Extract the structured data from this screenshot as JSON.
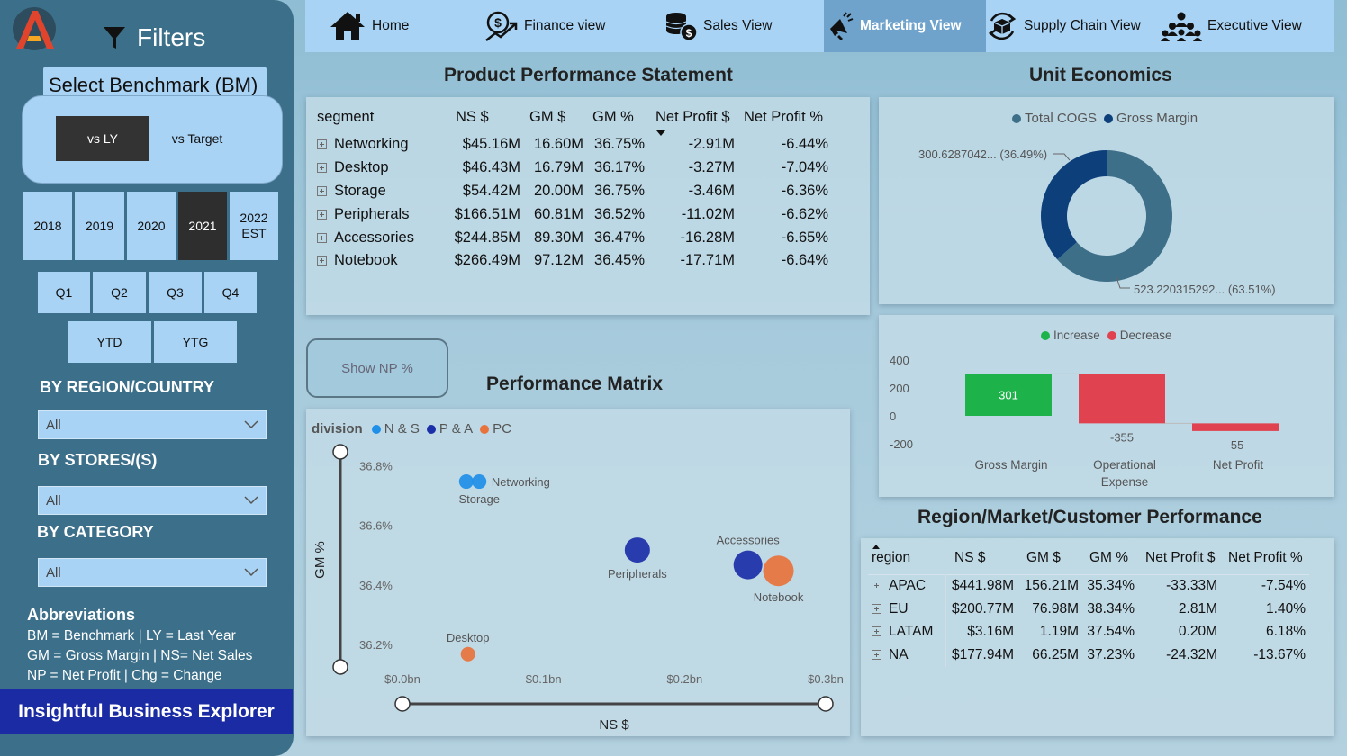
{
  "sidebar": {
    "filters_title": "Filters",
    "benchmark_label": "Select Benchmark (BM)",
    "benchmark_options": [
      "vs LY",
      "vs Target"
    ],
    "benchmark_selected": "vs LY",
    "years": [
      "2018",
      "2019",
      "2020",
      "2021",
      "2022 EST"
    ],
    "year_selected": "2021",
    "quarters": [
      "Q1",
      "Q2",
      "Q3",
      "Q4"
    ],
    "ytd": "YTD",
    "ytg": "YTG",
    "region_heading": "BY REGION/COUNTRY",
    "region_value": "All",
    "stores_heading": "BY STORES/(S)",
    "stores_value": "All",
    "category_heading": "BY CATEGORY",
    "category_value": "All",
    "abbr_heading": "Abbreviations",
    "abbr_lines": [
      "BM = Benchmark | LY = Last Year",
      "GM = Gross Margin | NS= Net Sales",
      "NP = Net Profit | Chg = Change"
    ],
    "brand": "Insightful Business Explorer"
  },
  "nav": {
    "items": [
      {
        "label": "Home",
        "icon": "home-icon"
      },
      {
        "label": "Finance view",
        "icon": "finance-icon"
      },
      {
        "label": "Sales View",
        "icon": "coins-icon"
      },
      {
        "label": "Marketing View",
        "icon": "megaphone-icon"
      },
      {
        "label": "Supply Chain View",
        "icon": "box-cycle-icon"
      },
      {
        "label": "Executive View",
        "icon": "team-icon"
      }
    ],
    "active": "Marketing View"
  },
  "product_table": {
    "title": "Product Performance Statement",
    "columns": [
      "segment",
      "NS $",
      "GM $",
      "GM %",
      "Net Profit $",
      "Net Profit %"
    ],
    "rows": [
      [
        "Networking",
        "$45.16M",
        "16.60M",
        "36.75%",
        "-2.91M",
        "-6.44%"
      ],
      [
        "Desktop",
        "$46.43M",
        "16.79M",
        "36.17%",
        "-3.27M",
        "-7.04%"
      ],
      [
        "Storage",
        "$54.42M",
        "20.00M",
        "36.75%",
        "-3.46M",
        "-6.36%"
      ],
      [
        "Peripherals",
        "$166.51M",
        "60.81M",
        "36.52%",
        "-11.02M",
        "-6.62%"
      ],
      [
        "Accessories",
        "$244.85M",
        "89.30M",
        "36.47%",
        "-16.28M",
        "-6.65%"
      ],
      [
        "Notebook",
        "$266.49M",
        "97.12M",
        "36.45%",
        "-17.71M",
        "-6.64%"
      ]
    ]
  },
  "unit_economics": {
    "title": "Unit Economics",
    "legend": [
      "Total COGS",
      "Gross Margin"
    ],
    "gm_label": "300.6287042... (36.49%)",
    "cogs_label": "523.220315292... (63.51%)",
    "colors": {
      "cogs": "#3e6f88",
      "gm": "#0d3f7a"
    }
  },
  "waterfall": {
    "legend": [
      "Increase",
      "Decrease"
    ],
    "colors": {
      "increase": "#1db34a",
      "decrease": "#e0434f"
    }
  },
  "show_np_button": "Show NP %",
  "matrix": {
    "title": "Performance Matrix",
    "legend_title": "division",
    "legend": [
      {
        "name": "N & S",
        "color": "#1f8fe8"
      },
      {
        "name": "P & A",
        "color": "#1b2fa8"
      },
      {
        "name": "PC",
        "color": "#e8733c"
      }
    ]
  },
  "region_table": {
    "title": "Region/Market/Customer Performance",
    "columns": [
      "region",
      "NS $",
      "GM $",
      "GM %",
      "Net Profit $",
      "Net Profit %"
    ],
    "rows": [
      [
        "APAC",
        "$441.98M",
        "156.21M",
        "35.34%",
        "-33.33M",
        "-7.54%"
      ],
      [
        "EU",
        "$200.77M",
        "76.98M",
        "38.34%",
        "2.81M",
        "1.40%"
      ],
      [
        "LATAM",
        "$3.16M",
        "1.19M",
        "37.54%",
        "0.20M",
        "6.18%"
      ],
      [
        "NA",
        "$177.94M",
        "66.25M",
        "37.23%",
        "-24.32M",
        "-13.67%"
      ]
    ]
  },
  "chart_data": [
    {
      "type": "pie",
      "title": "Unit Economics",
      "categories": [
        "Total COGS",
        "Gross Margin"
      ],
      "values": [
        523.22,
        300.63
      ],
      "percent": [
        63.51,
        36.49
      ]
    },
    {
      "type": "bar",
      "subtype": "waterfall",
      "categories": [
        "Gross Margin",
        "Operational Expense",
        "Net Profit"
      ],
      "category_lines": [
        [
          "Gross Margin"
        ],
        [
          "Operational",
          "Expense"
        ],
        [
          "Net Profit"
        ]
      ],
      "values": [
        301,
        -355,
        -55
      ],
      "labels": [
        "301",
        "-355",
        "-55"
      ],
      "ylim": [
        -200,
        400
      ],
      "yticks": [
        -200,
        0,
        200,
        400
      ],
      "legend": [
        "Increase",
        "Decrease"
      ]
    },
    {
      "type": "scatter",
      "title": "Performance Matrix",
      "xlabel": "NS $",
      "ylabel": "GM %",
      "xlim": [
        0,
        0.3
      ],
      "ylim": [
        36.13,
        36.85
      ],
      "xticks": [
        "$0.0bn",
        "$0.1bn",
        "$0.2bn",
        "$0.3bn"
      ],
      "yticks": [
        "36.2%",
        "36.4%",
        "36.6%",
        "36.8%"
      ],
      "series": [
        {
          "name": "N & S",
          "points": [
            {
              "label": "Networking",
              "x": 0.0452,
              "y": 36.75
            },
            {
              "label": "Storage",
              "x": 0.0544,
              "y": 36.75
            }
          ]
        },
        {
          "name": "P & A",
          "points": [
            {
              "label": "Peripherals",
              "x": 0.1665,
              "y": 36.52
            },
            {
              "label": "Accessories",
              "x": 0.2449,
              "y": 36.47
            }
          ]
        },
        {
          "name": "PC",
          "points": [
            {
              "label": "Desktop",
              "x": 0.0464,
              "y": 36.17
            },
            {
              "label": "Notebook",
              "x": 0.2665,
              "y": 36.45
            }
          ]
        }
      ]
    }
  ]
}
